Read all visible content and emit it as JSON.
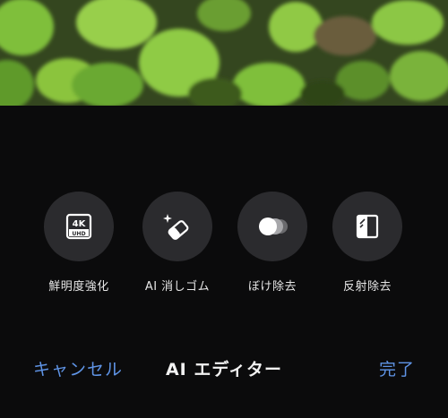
{
  "tools": [
    {
      "label": "鮮明度強化",
      "icon": "4k-uhd-icon",
      "badge_top": "4K",
      "badge_bottom": "UHD"
    },
    {
      "label": "AI 消しゴム",
      "icon": "eraser-sparkle-icon"
    },
    {
      "label": "ぼけ除去",
      "icon": "blur-remove-icon"
    },
    {
      "label": "反射除去",
      "icon": "reflection-remove-icon"
    }
  ],
  "bottom_bar": {
    "cancel_label": "キャンセル",
    "title": "AI エディター",
    "done_label": "完了"
  },
  "colors": {
    "accent": "#5f94e6",
    "background": "#0b0b0c",
    "tool_circle": "#2b2b2e"
  }
}
